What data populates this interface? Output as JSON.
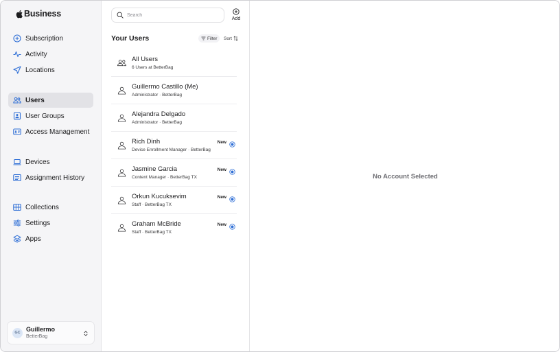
{
  "app": {
    "brand": "Business"
  },
  "sidebar": {
    "groups": [
      {
        "items": [
          {
            "label": "Subscription",
            "icon": "plus-circle-icon"
          },
          {
            "label": "Activity",
            "icon": "activity-icon"
          },
          {
            "label": "Locations",
            "icon": "location-arrow-icon"
          }
        ]
      },
      {
        "items": [
          {
            "label": "Users",
            "icon": "users-icon",
            "active": true
          },
          {
            "label": "User Groups",
            "icon": "user-groups-icon"
          },
          {
            "label": "Access Management",
            "icon": "id-card-icon"
          }
        ]
      },
      {
        "items": [
          {
            "label": "Devices",
            "icon": "laptop-icon"
          },
          {
            "label": "Assignment History",
            "icon": "list-card-icon"
          }
        ]
      },
      {
        "items": [
          {
            "label": "Collections",
            "icon": "grid-icon"
          },
          {
            "label": "Settings",
            "icon": "sliders-icon"
          },
          {
            "label": "Apps",
            "icon": "stack-icon"
          }
        ]
      }
    ],
    "account": {
      "initials": "GC",
      "name": "Guillermo",
      "org": "BetterBag"
    }
  },
  "list": {
    "search_placeholder": "Search",
    "add_label": "Add",
    "title": "Your Users",
    "filter_label": "Filter",
    "sort_label": "Sort",
    "rows": [
      {
        "name": "All Users",
        "sub": "6 Users at BetterBag",
        "icon": "people-icon",
        "new": ""
      },
      {
        "name": "Guillermo Castillo (Me)",
        "sub": "Administrator · BetterBag",
        "icon": "person-icon",
        "new": ""
      },
      {
        "name": "Alejandra Delgado",
        "sub": "Administrator · BetterBag",
        "icon": "person-icon",
        "new": ""
      },
      {
        "name": "Rich Dinh",
        "sub": "Device Enrollment Manager · BetterBag",
        "icon": "person-icon",
        "new": "New"
      },
      {
        "name": "Jasmine Garcia",
        "sub": "Content Manager · BetterBag TX",
        "icon": "person-icon",
        "new": "New"
      },
      {
        "name": "Orkun Kucuksevim",
        "sub": "Staff · BetterBag TX",
        "icon": "person-icon",
        "new": "New"
      },
      {
        "name": "Graham McBride",
        "sub": "Staff · BetterBag TX",
        "icon": "person-icon",
        "new": "New"
      }
    ]
  },
  "detail": {
    "empty_text": "No Account Selected"
  },
  "colors": {
    "accent": "#2f6fd6",
    "sidebar_bg": "#f5f5f7",
    "active_bg": "#e2e2e6"
  }
}
